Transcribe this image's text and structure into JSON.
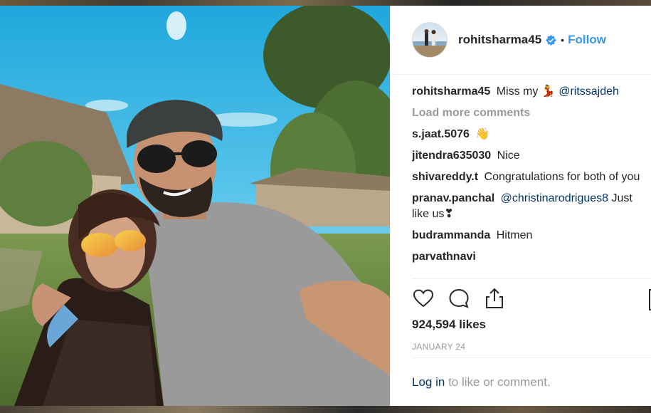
{
  "post": {
    "username": "rohitsharma45",
    "follow_label": "Follow",
    "separator": "•",
    "likes": "924,594 likes",
    "date": "JANUARY 24"
  },
  "caption": {
    "user": "rohitsharma45",
    "text": "Miss my 💃",
    "mention": "@ritssajdeh"
  },
  "load_more_label": "Load more comments",
  "comments": [
    {
      "user": "s.jaat.5076",
      "text": "👋"
    },
    {
      "user": "jitendra635030",
      "text": "Nice"
    },
    {
      "user": "shivareddy.t",
      "text": "Congratulations for both of you"
    },
    {
      "user": "pranav.panchal",
      "mention": "@christinarodrigues8",
      "text": "Just like us❣"
    },
    {
      "user": "budrammanda",
      "text": "Hitmen"
    },
    {
      "user": "parvathnavi",
      "text": ""
    }
  ],
  "login": {
    "link": "Log in",
    "text": "to like or comment."
  },
  "icons": {
    "like": "heart-icon",
    "comment": "comment-icon",
    "share": "share-icon",
    "verified": "verified-badge-icon"
  },
  "colors": {
    "accent": "#3897f0",
    "mention": "#003569",
    "muted": "#999999",
    "text": "#262626"
  }
}
